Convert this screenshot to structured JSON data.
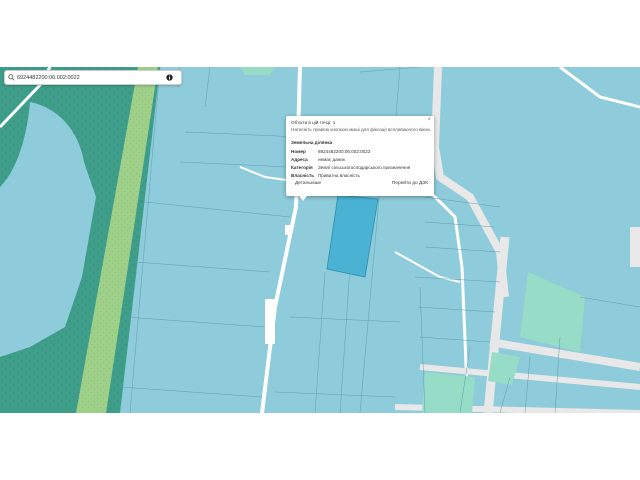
{
  "search": {
    "value": "6924482200:06:002:0022"
  },
  "popup": {
    "title": "Об'єкти в цій точці: 1",
    "hint": "Натисніть правою кнопкою миші для фіксації вспливаючого вікна.",
    "section_title": "Земельна ділянка",
    "rows": [
      {
        "label": "Номер",
        "value": "6924482200:06:002:0022"
      },
      {
        "label": "Адреса",
        "value": "немає даних"
      },
      {
        "label": "Категорія",
        "value": "Землі сільськогосподарського призначення"
      },
      {
        "label": "Власність",
        "value": "Приватна власність"
      }
    ],
    "details_label": "Детальніше",
    "goto_label": "Перейти до ДЗК",
    "close_symbol": "×"
  },
  "colors": {
    "parcel": "#8ecbdb",
    "selected_parcel": "#4ab3d4",
    "forest": "#3e9e8a",
    "meadow": "#96dcc7",
    "field_strip": "#9ed08a",
    "road": "#ffffff",
    "background": "#ffffff"
  },
  "icons": {
    "search": "magnifier-icon",
    "info": "info-icon",
    "close": "close-icon"
  }
}
